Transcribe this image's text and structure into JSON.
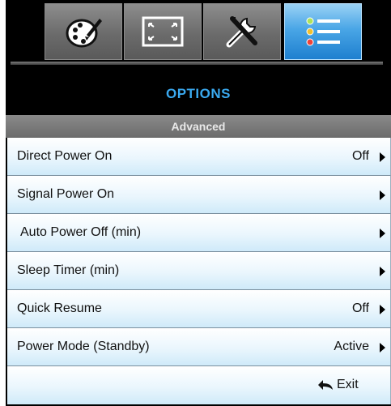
{
  "tabs": [
    {
      "icon": "palette-icon",
      "active": false
    },
    {
      "icon": "screen-expand-icon",
      "active": false
    },
    {
      "icon": "tools-icon",
      "active": false
    },
    {
      "icon": "options-list-icon",
      "active": true
    }
  ],
  "header": {
    "title": "OPTIONS",
    "subtitle": "Advanced"
  },
  "menu": {
    "items": [
      {
        "label": "Direct Power On",
        "value": "Off"
      },
      {
        "label": "Signal Power On",
        "value": ""
      },
      {
        "label": "Auto Power Off (min)",
        "value": ""
      },
      {
        "label": "Sleep Timer (min)",
        "value": ""
      },
      {
        "label": "Quick Resume",
        "value": "Off"
      },
      {
        "label": "Power Mode (Standby)",
        "value": "Active"
      }
    ],
    "exit_label": "Exit"
  },
  "colors": {
    "title": "#3aa9ef",
    "active_tab": "#4aa6e6"
  }
}
